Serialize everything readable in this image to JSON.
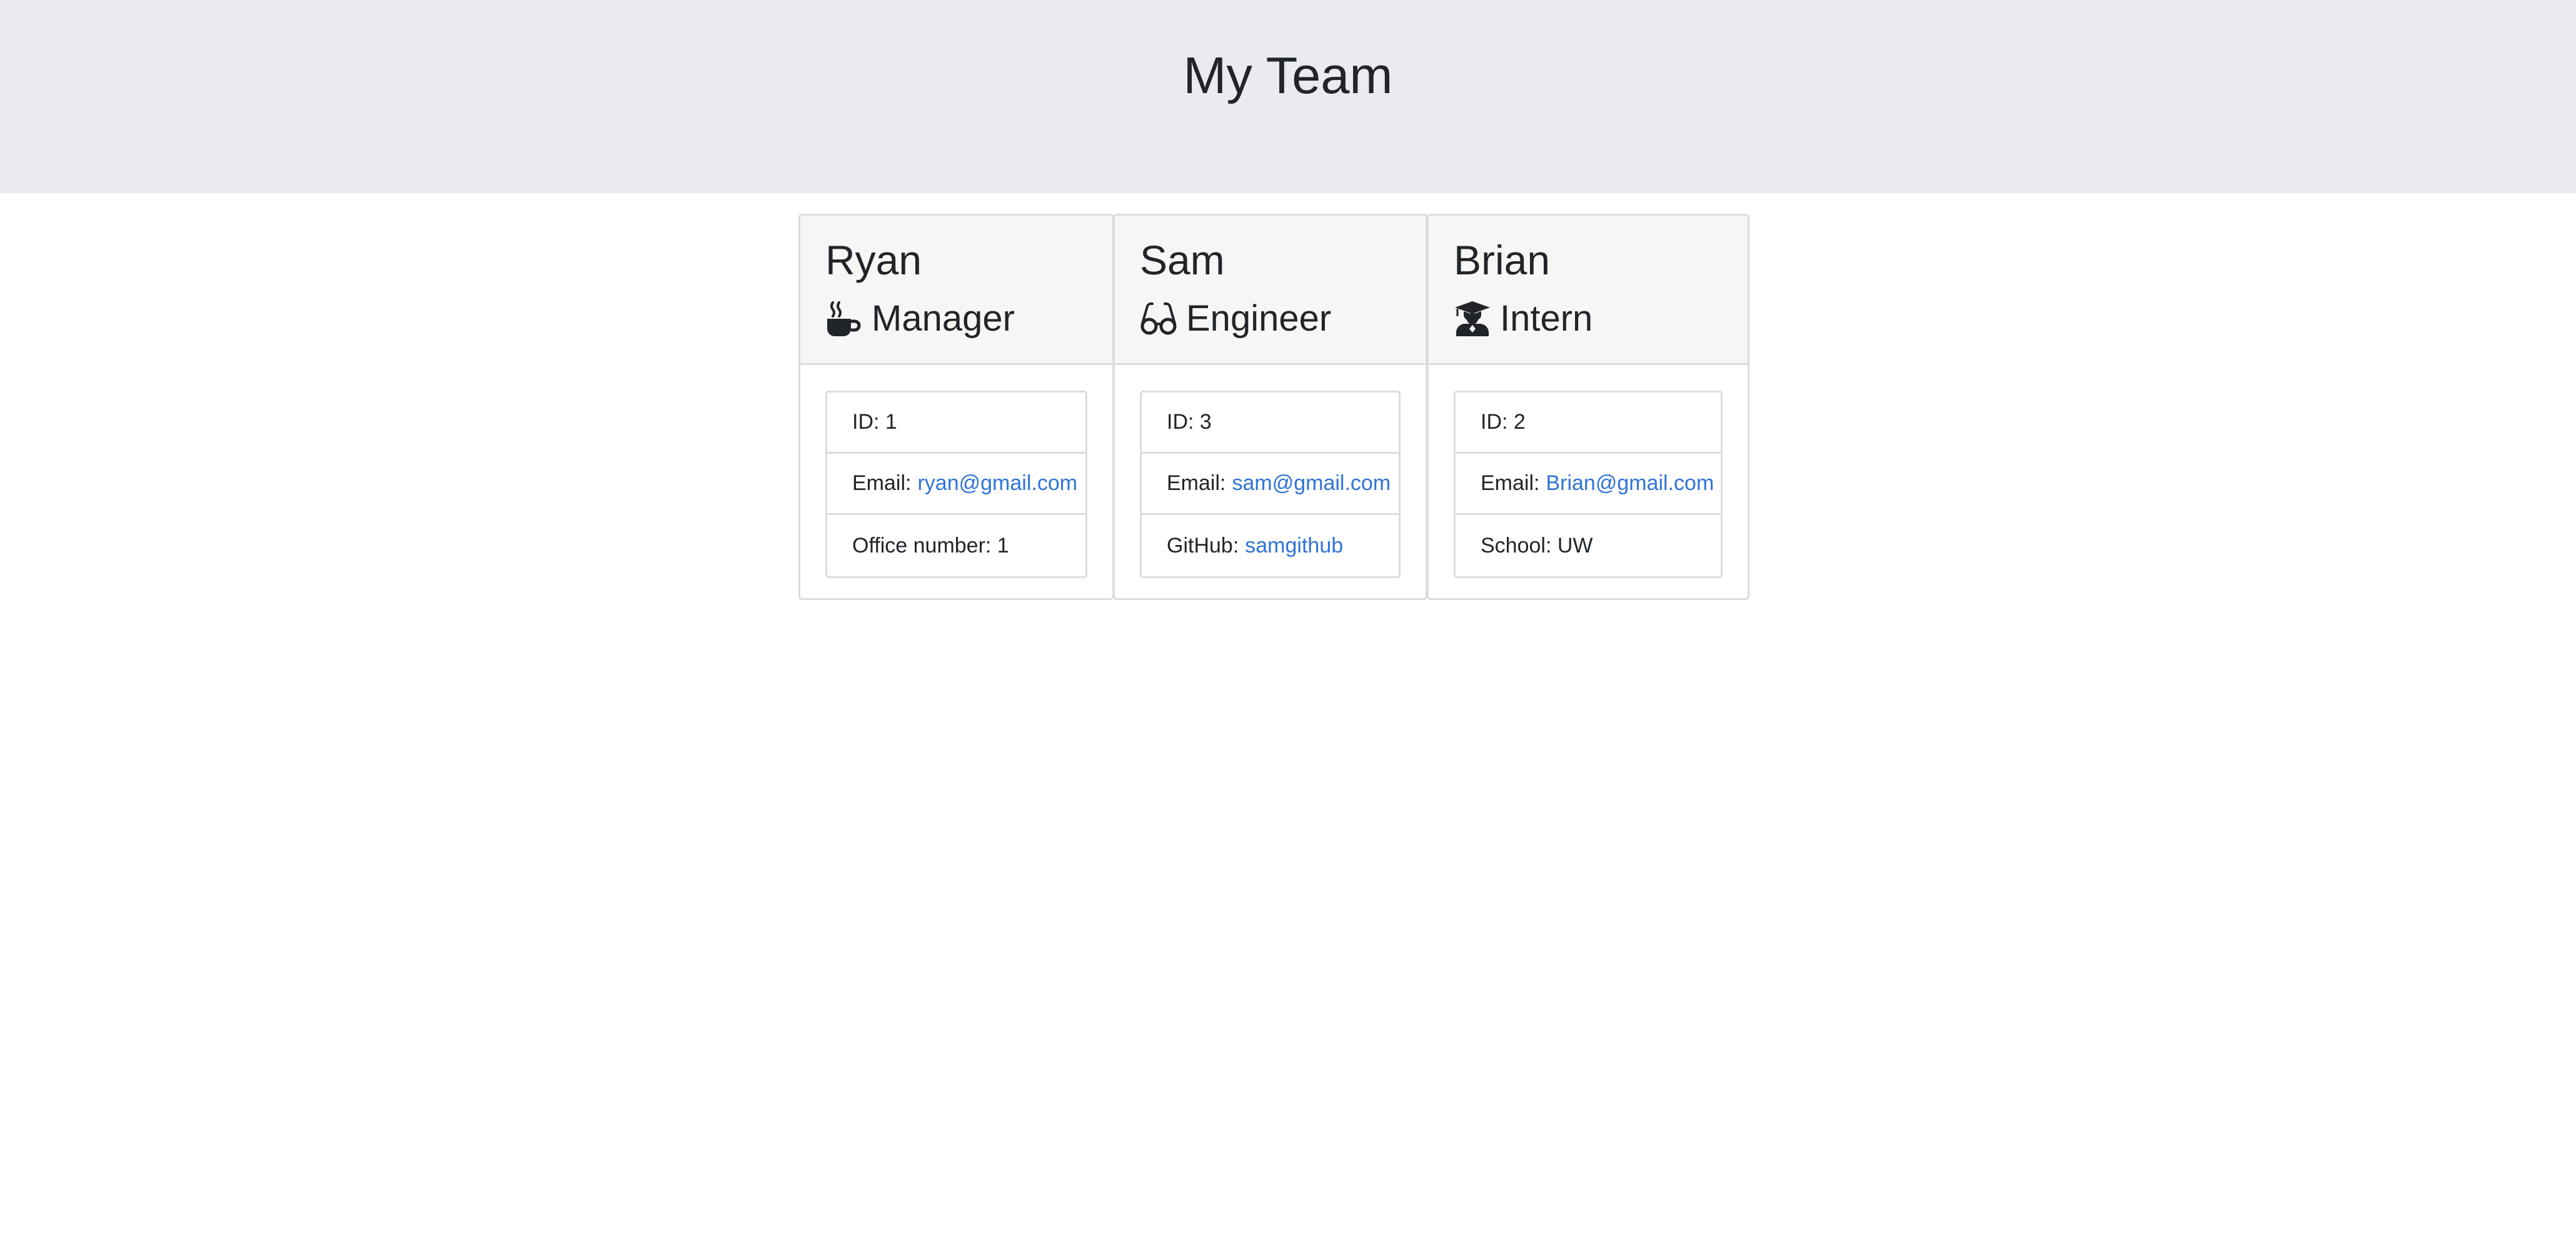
{
  "header": {
    "title": "My Team"
  },
  "employees": [
    {
      "name": "Ryan",
      "role": "Manager",
      "icon": "coffee-icon",
      "id_label": "ID: 1",
      "email_label": "Email:",
      "email": "ryan@gmail.com",
      "extra_label": "Office number: 1",
      "extra_link": ""
    },
    {
      "name": "Sam",
      "role": "Engineer",
      "icon": "glasses-icon",
      "id_label": "ID: 3",
      "email_label": "Email:",
      "email": "sam@gmail.com",
      "extra_label": "GitHub:",
      "extra_link": "samgithub"
    },
    {
      "name": "Brian",
      "role": "Intern",
      "icon": "graduate-icon",
      "id_label": "ID: 2",
      "email_label": "Email:",
      "email": "Brian@gmail.com",
      "extra_label": "School: UW",
      "extra_link": ""
    }
  ],
  "colors": {
    "link": "#2f74d8",
    "header_bg": "#e9ebee",
    "card_header_bg": "#f6f6f6"
  }
}
